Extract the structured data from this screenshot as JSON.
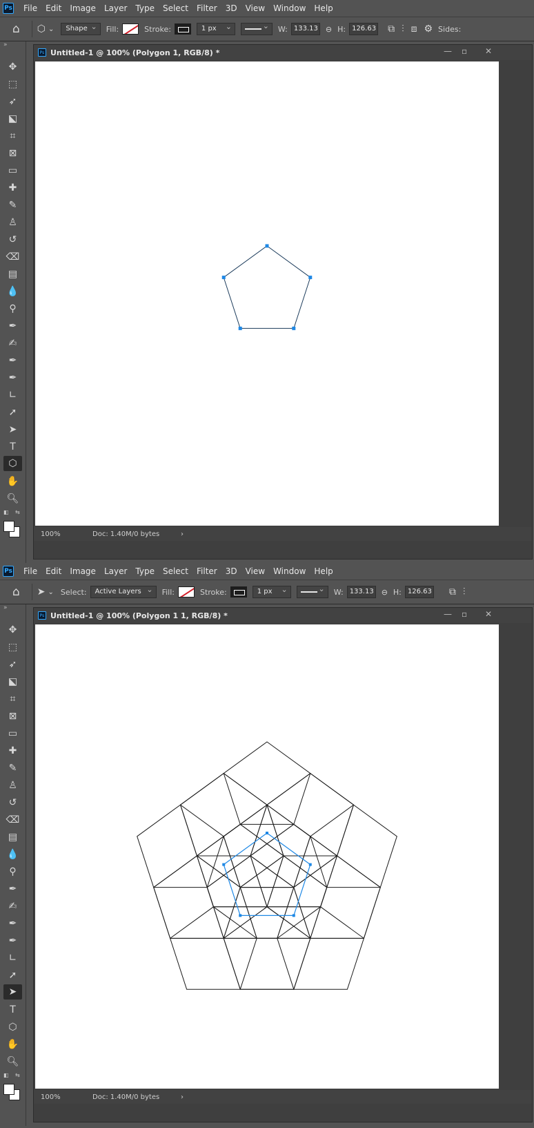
{
  "menu": [
    "File",
    "Edit",
    "Image",
    "Layer",
    "Type",
    "Select",
    "Filter",
    "3D",
    "View",
    "Window",
    "Help"
  ],
  "logo_text": "Ps",
  "screen1": {
    "options": {
      "mode": "Shape",
      "fill_label": "Fill:",
      "stroke_label": "Stroke:",
      "stroke_width": "1 px",
      "w_label": "W:",
      "w_value": "133.13 p",
      "h_label": "H:",
      "h_value": "126.63 p",
      "sides_label": "Sides:"
    },
    "doc_title": "Untitled-1 @ 100% (Polygon 1, RGB/8) *",
    "zoom": "100%",
    "doc_info": "Doc: 1.40M/0 bytes",
    "active_tool": "polygon-tool"
  },
  "screen2": {
    "options": {
      "select_label": "Select:",
      "select_value": "Active Layers",
      "fill_label": "Fill:",
      "stroke_label": "Stroke:",
      "stroke_width": "1 px",
      "w_label": "W:",
      "w_value": "133.13 p",
      "h_label": "H:",
      "h_value": "126.63 p"
    },
    "doc_title": "Untitled-1 @ 100% (Polygon 1 1, RGB/8) *",
    "zoom": "100%",
    "doc_info": "Doc: 1.40M/0 bytes",
    "active_tool": "path-selection-tool"
  },
  "colors": {
    "ui_bg": "#535353",
    "accent": "#31a8ff",
    "anchor": "#1e88e5",
    "stroke": "#1a1a1a"
  }
}
